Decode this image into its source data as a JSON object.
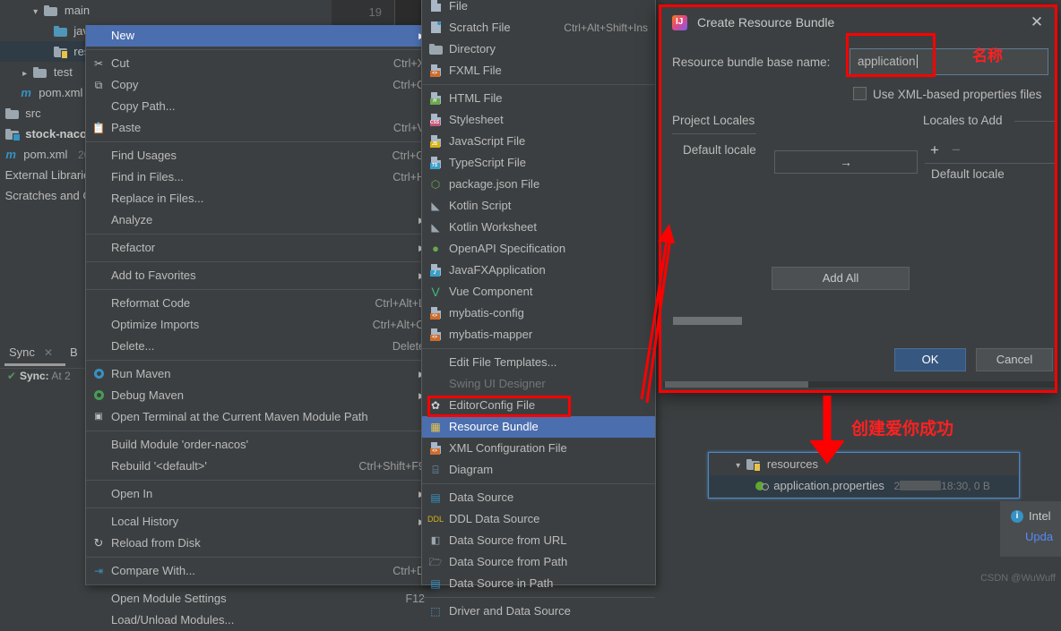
{
  "project_tree": {
    "items": [
      {
        "label": "main",
        "icon": "folder-icon",
        "indent": 30,
        "arrow": "chevron-down",
        "bold": false
      },
      {
        "label": "jav",
        "icon": "folder-blue-icon",
        "indent": 56,
        "arrow": "",
        "bold": false
      },
      {
        "label": "res",
        "icon": "folder-resources-icon",
        "indent": 56,
        "arrow": "",
        "bold": false,
        "selected": true
      },
      {
        "label": "test",
        "icon": "folder-icon",
        "indent": 30,
        "arrow": "chevron-right",
        "bold": false
      },
      {
        "label": "pom.xml",
        "icon": "maven-icon",
        "indent": 18,
        "arrow": "",
        "bold": false
      },
      {
        "label": "src",
        "icon": "folder-icon",
        "indent": 0,
        "arrow": "",
        "bold": false
      },
      {
        "label": "stock-nacos",
        "icon": "module-icon",
        "indent": 0,
        "arrow": "",
        "bold": true
      },
      {
        "label": "pom.xml",
        "icon": "maven-icon",
        "indent": 0,
        "arrow": "",
        "bold": false,
        "meta": "20"
      },
      {
        "label": "External Librarie",
        "icon": "",
        "indent": 0,
        "arrow": "",
        "bold": false
      },
      {
        "label": "Scratches and C",
        "icon": "",
        "indent": 0,
        "arrow": "",
        "bold": false
      }
    ],
    "gutter_line_number": "19"
  },
  "sync_panel": {
    "tab_label": "Sync",
    "close_icon": "close-icon",
    "secondary_tab": "B",
    "status_icon": "check-icon",
    "status_prefix": "Sync:",
    "status_text": "At 2"
  },
  "context_menu": {
    "items": [
      {
        "label": "New",
        "accel": "",
        "submenu": true,
        "highlighted": true,
        "icon": "",
        "mnemonic": ""
      },
      {
        "sep": true
      },
      {
        "label": "Cut",
        "accel": "Ctrl+X",
        "icon": "scissors-icon"
      },
      {
        "label": "Copy",
        "accel": "Ctrl+C",
        "icon": "copy-icon"
      },
      {
        "label": "Copy Path...",
        "accel": "",
        "icon": ""
      },
      {
        "label": "Paste",
        "accel": "Ctrl+V",
        "icon": "clipboard-icon"
      },
      {
        "sep": true
      },
      {
        "label": "Find Usages",
        "accel": "Ctrl+G",
        "icon": ""
      },
      {
        "label": "Find in Files...",
        "accel": "Ctrl+H",
        "icon": ""
      },
      {
        "label": "Replace in Files...",
        "accel": "",
        "icon": ""
      },
      {
        "label": "Analyze",
        "accel": "",
        "submenu": true,
        "icon": ""
      },
      {
        "sep": true
      },
      {
        "label": "Refactor",
        "accel": "",
        "submenu": true,
        "icon": ""
      },
      {
        "sep": true
      },
      {
        "label": "Add to Favorites",
        "accel": "",
        "submenu": true,
        "icon": ""
      },
      {
        "sep": true
      },
      {
        "label": "Reformat Code",
        "accel": "Ctrl+Alt+L",
        "icon": ""
      },
      {
        "label": "Optimize Imports",
        "accel": "Ctrl+Alt+O",
        "icon": ""
      },
      {
        "label": "Delete...",
        "accel": "Delete",
        "icon": ""
      },
      {
        "sep": true
      },
      {
        "label": "Run Maven",
        "accel": "",
        "submenu": true,
        "icon": "gear-blue-icon"
      },
      {
        "label": "Debug Maven",
        "accel": "",
        "submenu": true,
        "icon": "gear-green-icon"
      },
      {
        "label": "Open Terminal at the Current Maven Module Path",
        "accel": "",
        "icon": "terminal-icon"
      },
      {
        "sep": true
      },
      {
        "label": "Build Module 'order-nacos'",
        "accel": "",
        "icon": ""
      },
      {
        "label": "Rebuild '<default>'",
        "accel": "Ctrl+Shift+F9",
        "icon": ""
      },
      {
        "sep": true
      },
      {
        "label": "Open In",
        "accel": "",
        "submenu": true,
        "icon": ""
      },
      {
        "sep": true
      },
      {
        "label": "Local History",
        "accel": "",
        "submenu": true,
        "icon": ""
      },
      {
        "label": "Reload from Disk",
        "accel": "",
        "icon": "refresh-icon"
      },
      {
        "sep": true
      },
      {
        "label": "Compare With...",
        "accel": "Ctrl+D",
        "icon": "compare-icon"
      },
      {
        "sep": true
      },
      {
        "label": "Open Module Settings",
        "accel": "F12",
        "icon": ""
      },
      {
        "label": "Load/Unload Modules...",
        "accel": "",
        "icon": ""
      }
    ]
  },
  "new_submenu": {
    "items": [
      {
        "label": "File",
        "accel": "",
        "icon": "file-icon"
      },
      {
        "label": "Scratch File",
        "accel": "Ctrl+Alt+Shift+Ins",
        "icon": "scratch-file-icon"
      },
      {
        "label": "Directory",
        "accel": "",
        "icon": "directory-icon"
      },
      {
        "label": "FXML File",
        "accel": "",
        "icon": "fxml-file-icon",
        "tag": "<>",
        "tagcolor": "#cc6d2e"
      },
      {
        "sep": true
      },
      {
        "label": "HTML File",
        "accel": "",
        "icon": "html-file-icon",
        "tag": "H",
        "tagcolor": "#6aa84f"
      },
      {
        "label": "Stylesheet",
        "accel": "",
        "icon": "css-file-icon",
        "tag": "CSS",
        "tagcolor": "#c5557a"
      },
      {
        "label": "JavaScript File",
        "accel": "",
        "icon": "js-file-icon",
        "tag": "JS",
        "tagcolor": "#d6b117"
      },
      {
        "label": "TypeScript File",
        "accel": "",
        "icon": "ts-file-icon",
        "tag": "TS",
        "tagcolor": "#3b9ecb"
      },
      {
        "label": "package.json File",
        "accel": "",
        "icon": "packagejson-icon"
      },
      {
        "label": "Kotlin Script",
        "accel": "",
        "icon": "kotlin-icon"
      },
      {
        "label": "Kotlin Worksheet",
        "accel": "",
        "icon": "kotlin-icon"
      },
      {
        "label": "OpenAPI Specification",
        "accel": "",
        "icon": "openapi-icon"
      },
      {
        "label": "JavaFXApplication",
        "accel": "",
        "icon": "javafx-icon",
        "tag": "J",
        "tagcolor": "#3b9ecb"
      },
      {
        "label": "Vue Component",
        "accel": "",
        "icon": "vue-icon"
      },
      {
        "label": "mybatis-config",
        "accel": "",
        "icon": "xml-file-icon",
        "tag": "<>",
        "tagcolor": "#cc6d2e"
      },
      {
        "label": "mybatis-mapper",
        "accel": "",
        "icon": "xml-file-icon",
        "tag": "<>",
        "tagcolor": "#cc6d2e"
      },
      {
        "sep": true
      },
      {
        "label": "Edit File Templates...",
        "accel": "",
        "icon": ""
      },
      {
        "label": "Swing UI Designer",
        "accel": "",
        "icon": "",
        "disabled": true
      },
      {
        "label": "EditorConfig File",
        "accel": "",
        "icon": "editorconfig-icon"
      },
      {
        "label": "Resource Bundle",
        "accel": "",
        "icon": "resource-bundle-icon",
        "highlighted": true
      },
      {
        "label": "XML Configuration File",
        "accel": "",
        "icon": "xml-file-icon",
        "tag": "<>",
        "tagcolor": "#cc6d2e"
      },
      {
        "label": "Diagram",
        "accel": "",
        "icon": "diagram-icon"
      },
      {
        "sep": true
      },
      {
        "label": "Data Source",
        "accel": "",
        "icon": "datasource-icon"
      },
      {
        "label": "DDL Data Source",
        "accel": "",
        "icon": "ddl-icon"
      },
      {
        "label": "Data Source from URL",
        "accel": "",
        "icon": "datasource-url-icon"
      },
      {
        "label": "Data Source from Path",
        "accel": "",
        "icon": "folder-open-icon"
      },
      {
        "label": "Data Source in Path",
        "accel": "",
        "icon": "datasource-icon"
      },
      {
        "sep": true
      },
      {
        "label": "Driver and Data Source",
        "accel": "",
        "icon": "driver-icon"
      }
    ]
  },
  "dialog": {
    "app_icon": "intellij-idea-icon",
    "title": "Create Resource Bundle",
    "close_icon": "close-icon",
    "base_name_label": "Resource bundle base name:",
    "base_name_value": "application",
    "xml_checkbox_label": "Use XML-based properties files",
    "xml_checkbox_checked": false,
    "project_locales_label": "Project Locales",
    "default_locale_left": "Default locale",
    "transfer_button_icon": "arrow-right-icon",
    "locales_to_add_label": "Locales to Add",
    "add_locale_icon": "plus-icon",
    "remove_locale_icon": "minus-icon",
    "default_locale_right": "Default locale",
    "add_all_label": "Add All",
    "ok_label": "OK",
    "cancel_label": "Cancel"
  },
  "annotations": {
    "name_note": "名称",
    "success_note": "创建爱你成功",
    "highlight_color": "#ff0000"
  },
  "result_tree": {
    "folder_label": "resources",
    "folder_icon": "folder-resources-icon",
    "expand_icon": "chevron-down-icon",
    "file_label": "application.properties",
    "file_icon": "properties-file-icon",
    "file_meta_prefix": "2",
    "file_meta_suffix": "18:30, 0 B"
  },
  "notification": {
    "icon": "info-icon",
    "title": "Intel",
    "link": "Upda"
  },
  "watermark": "CSDN @WuWuff"
}
